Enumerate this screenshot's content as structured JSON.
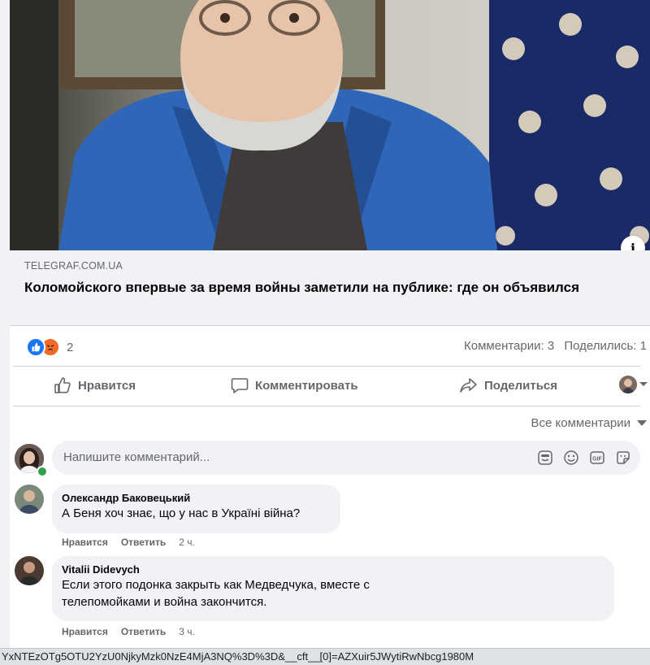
{
  "post": {
    "link": {
      "domain": "TELEGRAF.COM.UA",
      "headline": "Коломойского впервые за время войны заметили на публике: где он объявился"
    },
    "reactions": {
      "count": "2",
      "types": [
        "like-icon",
        "angry-icon"
      ]
    },
    "stats": {
      "comments": "Комментарии: 3",
      "shares": "Поделились: 1"
    },
    "actions": {
      "like": "Нравится",
      "comment": "Комментировать",
      "share": "Поделиться"
    }
  },
  "comments_section": {
    "filter_label": "Все комментарии",
    "composer_placeholder": "Напишите комментарий...",
    "items": [
      {
        "author": "Олександр Баковецький",
        "text": "А Беня хоч знає, що у нас в Україні війна?",
        "like": "Нравится",
        "reply": "Ответить",
        "time": "2 ч."
      },
      {
        "author": "Vitalii Didevych",
        "text_line1": "Если этого подонка закрыть как Медведчука, вместе с",
        "text_line2": "телепомойками и война закончится.",
        "like": "Нравится",
        "reply": "Ответить",
        "time": "3 ч."
      }
    ]
  },
  "statusbar": {
    "url": "YxNTEzOTg5OTU2YzU0NjkyMzk0NzE4MjA3NQ%3D%3D&__cft__[0]=AZXuir5JWytiRwNbcg1980M"
  },
  "colors": {
    "accent": "#1877f2",
    "angry": "#f06b2a",
    "secondary_text": "#65676b",
    "bubble": "#f0f2f5"
  }
}
